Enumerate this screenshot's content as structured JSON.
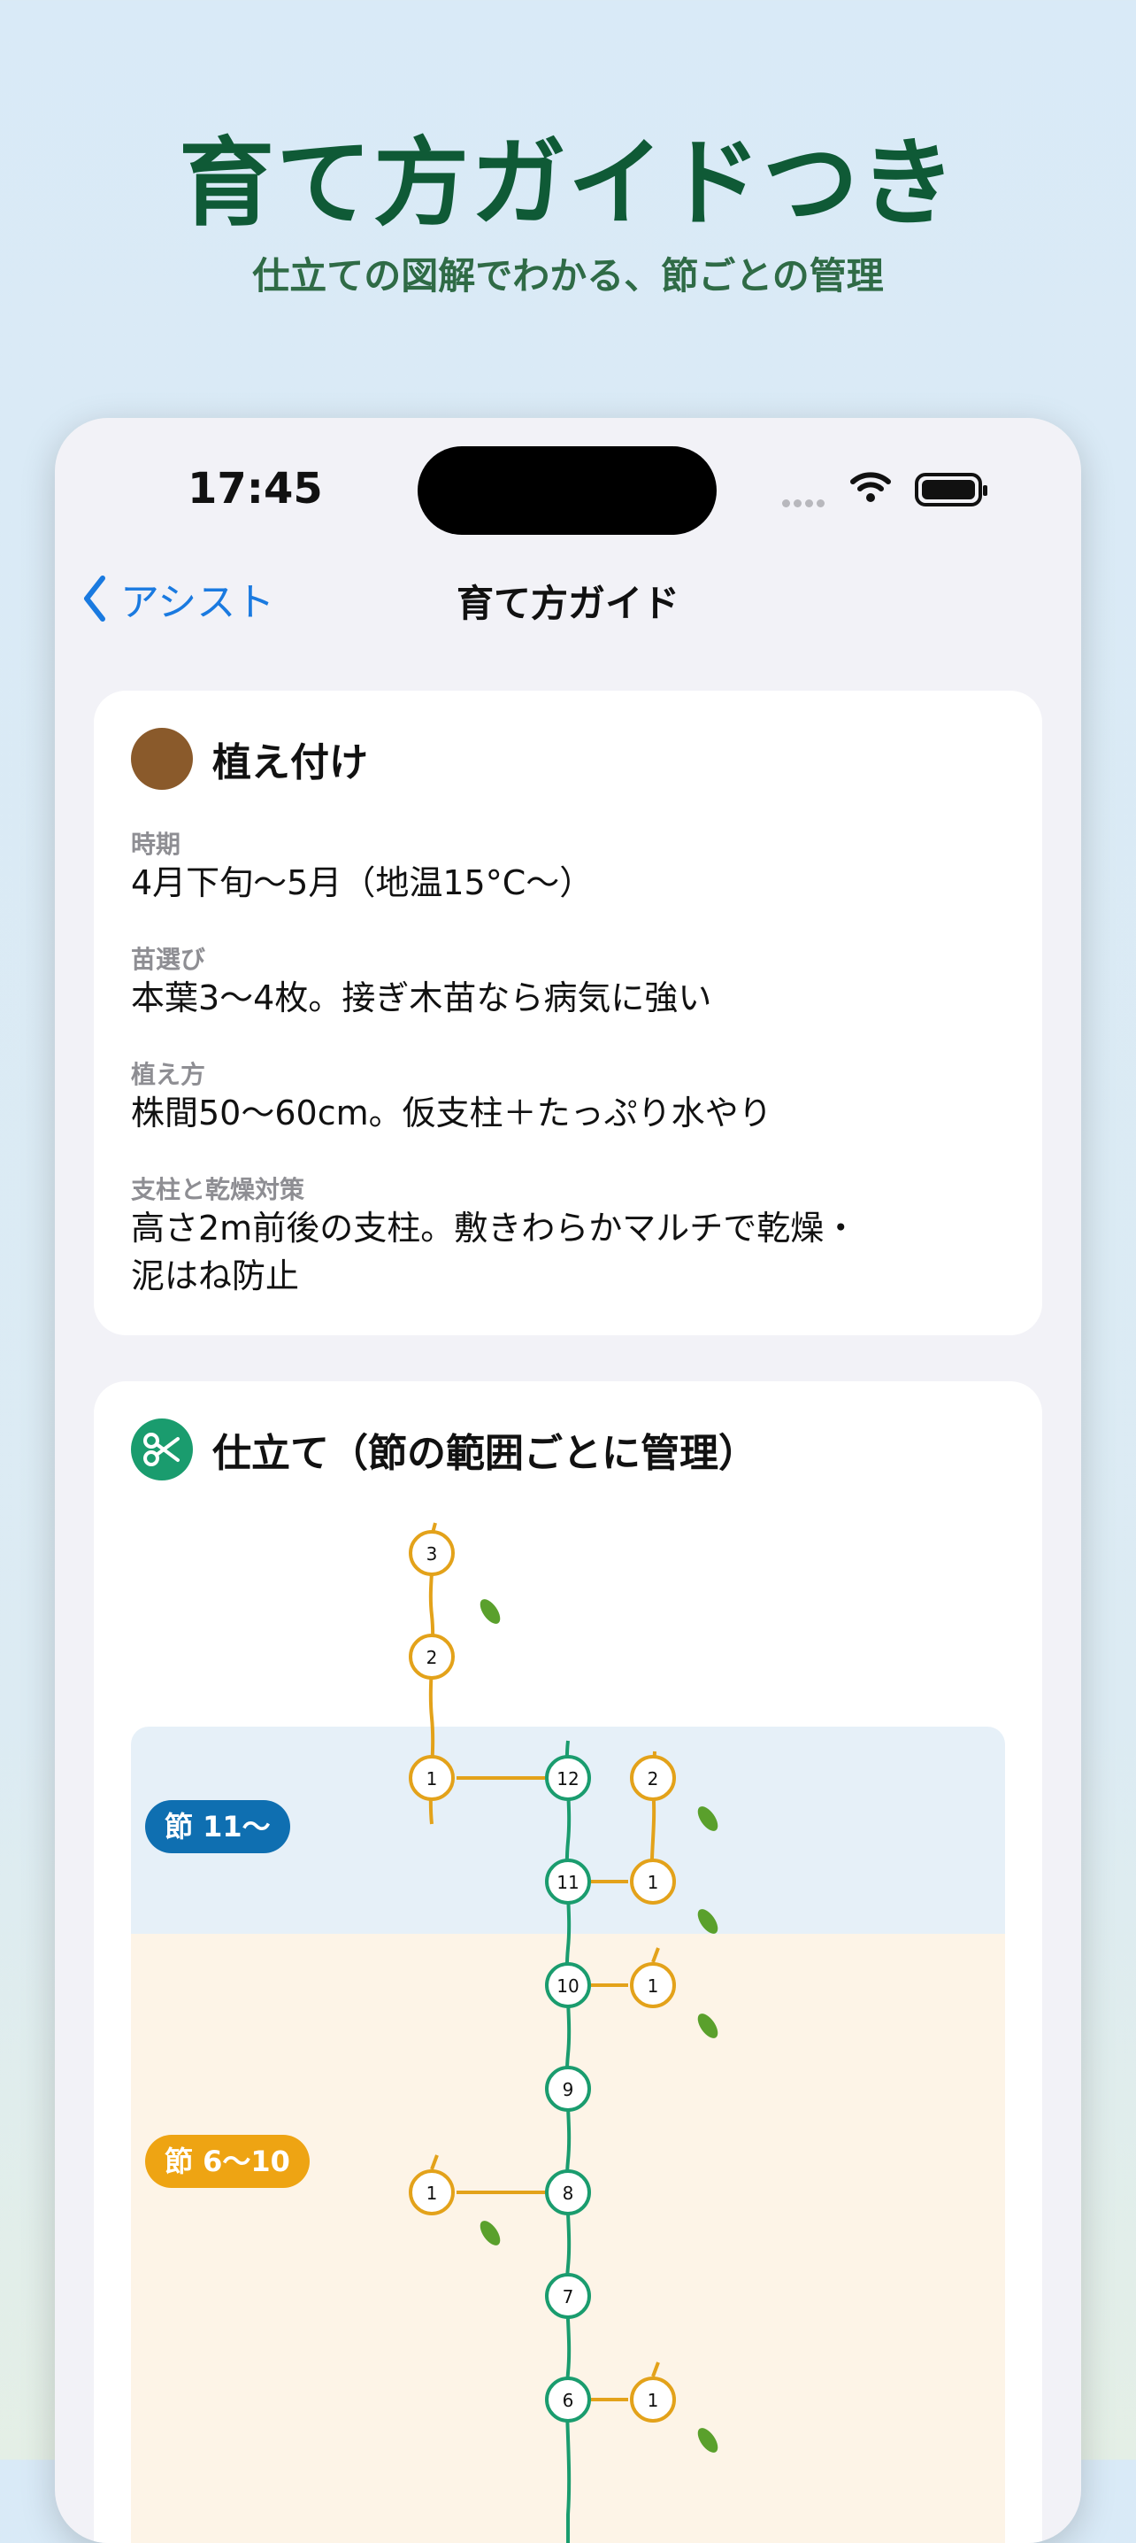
{
  "promo": {
    "headline": "育て方ガイドつき",
    "subline": "仕立ての図解でわかる、節ごとの管理"
  },
  "status_bar": {
    "time": "17:45"
  },
  "nav": {
    "back_label": "アシスト",
    "title": "育て方ガイド"
  },
  "planting_card": {
    "title": "植え付け",
    "icon_color": "#8a5a2b",
    "fields": [
      {
        "label": "時期",
        "value": "4月下旬〜5月（地温15°C〜）"
      },
      {
        "label": "苗選び",
        "value": "本葉3〜4枚。接ぎ木苗なら病気に強い"
      },
      {
        "label": "植え方",
        "value": "株間50〜60cm。仮支柱＋たっぷり水やり"
      },
      {
        "label": "支柱と乾燥対策",
        "value_line1": "高さ2m前後の支柱。敷きわらかマルチで乾燥・",
        "value_line2": "泥はね防止"
      }
    ]
  },
  "training_card": {
    "title": "仕立て（節の範囲ごとに管理）",
    "icon_color": "#1a9c6e",
    "bands": [
      {
        "label": "節 11〜",
        "color": "#0f6fb1"
      },
      {
        "label": "節 6〜10",
        "color": "#eea413"
      }
    ],
    "main_nodes": [
      "12",
      "11",
      "10",
      "9",
      "8",
      "7",
      "6"
    ],
    "side_branch_nodes": {
      "top_vine": [
        "3",
        "2",
        "1"
      ],
      "right_vine_upper": [
        "2",
        "1"
      ],
      "single_node_label": "1"
    },
    "colors": {
      "main_stem": "#1a9c6e",
      "side_shoot": "#e3a21a",
      "fruit": "#5aa02c"
    }
  }
}
